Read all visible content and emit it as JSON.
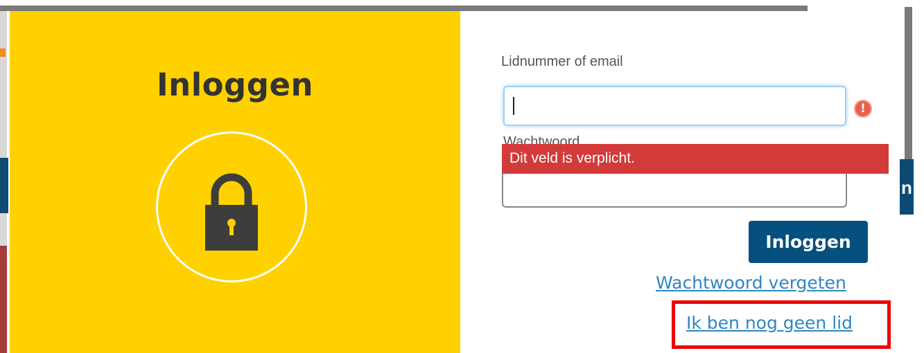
{
  "modal": {
    "title": "Inloggen",
    "username_label": "Lidnummer of email",
    "username_value": "",
    "password_label": "Wachtwoord",
    "error_message": "Dit veld is verplicht.",
    "error_icon": "!",
    "submit_label": "Inloggen",
    "forgot_password_label": "Wachtwoord vergeten",
    "not_member_label": "Ik ben nog geen lid",
    "icons": {
      "lock": "lock-icon",
      "alert": "alert-icon"
    }
  },
  "background": {
    "partial_text": "n"
  },
  "colors": {
    "accent_yellow": "#ffd100",
    "button_blue": "#05507f",
    "error_red": "#d33a3a",
    "link_blue": "#2f86c0",
    "highlight_red": "#ee0000"
  }
}
